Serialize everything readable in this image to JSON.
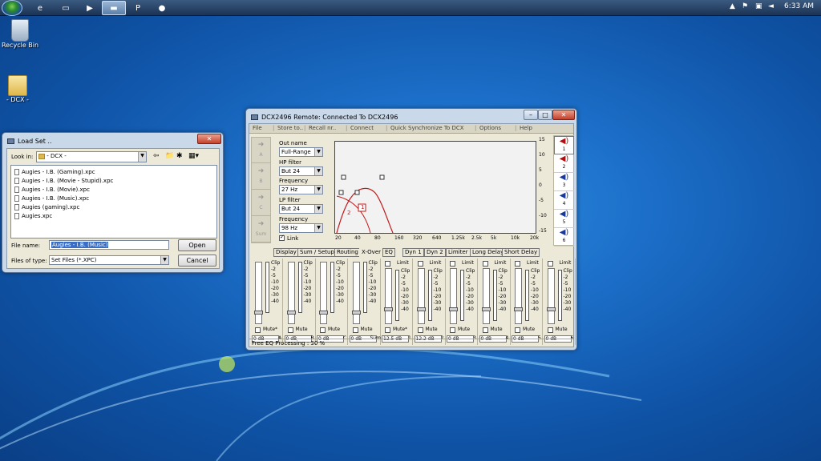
{
  "taskbar": {
    "clock": "6:33 AM"
  },
  "desktop": {
    "icons": [
      {
        "label": "Recycle Bin"
      },
      {
        "label": "- DCX -"
      }
    ]
  },
  "load_dialog": {
    "title": "Load Set ..",
    "look_in_label": "Look in:",
    "look_in_value": "- DCX -",
    "files": [
      "Augies - I.B. (Gaming).xpc",
      "Augies - I.B. (Movie - Stupid).xpc",
      "Augies - I.B. (Movie).xpc",
      "Augies - I.B. (Music).xpc",
      "Augies (gaming).xpc",
      "Augies.xpc"
    ],
    "filename_label": "File name:",
    "filename_value": "Augies - I.B. (Music)",
    "filetype_label": "Files of type:",
    "filetype_value": "Set Files (*.XPC)",
    "open": "Open",
    "cancel": "Cancel"
  },
  "dcx": {
    "title": "DCX2496 Remote: Connected To DCX2496",
    "menu": [
      "File",
      "Store to..",
      "Recall nr..",
      "Connect",
      "Quick Synchronize To DCX",
      "Options",
      "Help"
    ],
    "inputs": [
      "A",
      "B",
      "C",
      "Sum"
    ],
    "out_name_label": "Out name",
    "out_name": "Full-Range",
    "hp_label": "HP filter",
    "hp_type": "But 24",
    "hp_freq_label": "Frequency",
    "hp_freq": "27 Hz",
    "lp_label": "LP filter",
    "lp_type": "But 24",
    "lp_freq_label": "Frequency",
    "lp_freq": "98 Hz",
    "link_label": "Link",
    "graph_x": [
      "20",
      "40",
      "80",
      "160",
      "320",
      "640",
      "1.25k",
      "2.5k",
      "5k",
      "10k",
      "20k"
    ],
    "graph_y": [
      "15",
      "10",
      "5",
      "0",
      "-5",
      "-10",
      "-15"
    ],
    "marker_1": "1",
    "marker_2": "2",
    "outputs": [
      "1",
      "2",
      "3",
      "4",
      "5",
      "6"
    ],
    "output_colors": [
      "#b01010",
      "#b01010",
      "#1a3a9a",
      "#1a3a9a",
      "#1a3a9a",
      "#1a3a9a"
    ],
    "tabs": [
      "Display",
      "Sum / Setup",
      "Routing",
      "X-Over",
      "EQ",
      "Dyn 1",
      "Dyn 2",
      "Limiter",
      "Long Delay",
      "Short Delay"
    ],
    "meter_scale": [
      "Clip",
      "-2",
      "-5",
      "-10",
      "-20",
      "-30",
      "-40"
    ],
    "strips": [
      {
        "mute": "Mute*",
        "value": "0 dB",
        "ch": "A",
        "limit": ""
      },
      {
        "mute": "Mute",
        "value": "0 dB",
        "ch": "B",
        "limit": ""
      },
      {
        "mute": "Mute",
        "value": "0 dB",
        "ch": "C",
        "limit": ""
      },
      {
        "mute": "Mute",
        "value": "0 dB",
        "ch": "Sum",
        "limit": ""
      },
      {
        "mute": "Mute*",
        "value": "12.5 dB",
        "ch": "1",
        "limit": "Limit"
      },
      {
        "mute": "Mute",
        "value": "12.2 dB",
        "ch": "2",
        "limit": "Limit"
      },
      {
        "mute": "Mute",
        "value": "0 dB",
        "ch": "3",
        "limit": "Limit"
      },
      {
        "mute": "Mute",
        "value": "0 dB",
        "ch": "4",
        "limit": "Limit"
      },
      {
        "mute": "Mute",
        "value": "0 dB",
        "ch": "5",
        "limit": "Limit"
      },
      {
        "mute": "Mute",
        "value": "0 dB",
        "ch": "6",
        "limit": "Limit"
      }
    ],
    "status": "Free EQ Processing : 30 %"
  }
}
